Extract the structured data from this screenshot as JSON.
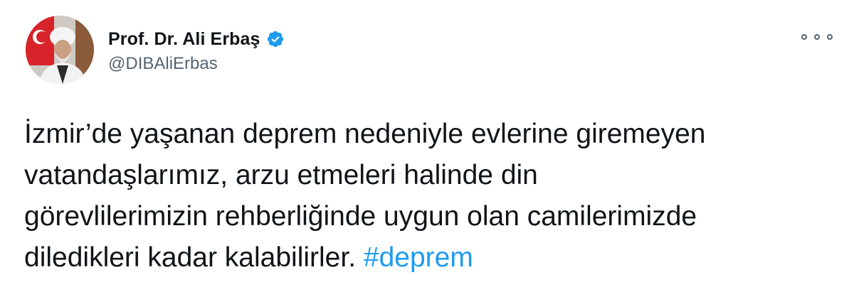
{
  "author": {
    "display_name": "Prof. Dr. Ali Erbaş",
    "handle": "@DIBAliErbas",
    "verified": true,
    "avatar_icon": "profile-photo"
  },
  "menu": {
    "icon": "more-options-icon"
  },
  "tweet": {
    "lines": [
      "İzmir’de yaşanan deprem nedeniyle evlerine giremeyen",
      "vatandaşlarımız, arzu etmeleri halinde din",
      "görevlilerimizin rehberliğinde uygun olan camilerimizde",
      "diledikleri kadar kalabilirler."
    ],
    "hashtag": "#deprem"
  },
  "colors": {
    "text": "#0f1419",
    "secondary": "#536471",
    "accent": "#1d9bf0"
  }
}
